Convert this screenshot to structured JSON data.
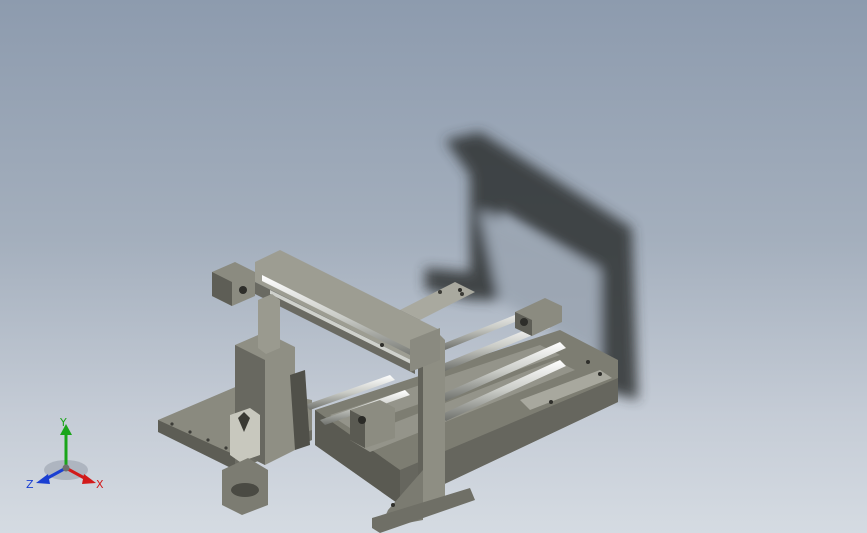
{
  "viewport": {
    "background_top": "#8d9bae",
    "background_bottom": "#d5dbe2",
    "model": "gantry-frame-assembly"
  },
  "triad": {
    "x_label": "X",
    "y_label": "Y",
    "z_label": "Z",
    "x_color": "#d21a1a",
    "y_color": "#1aa51a",
    "z_color": "#1a3fd2"
  }
}
